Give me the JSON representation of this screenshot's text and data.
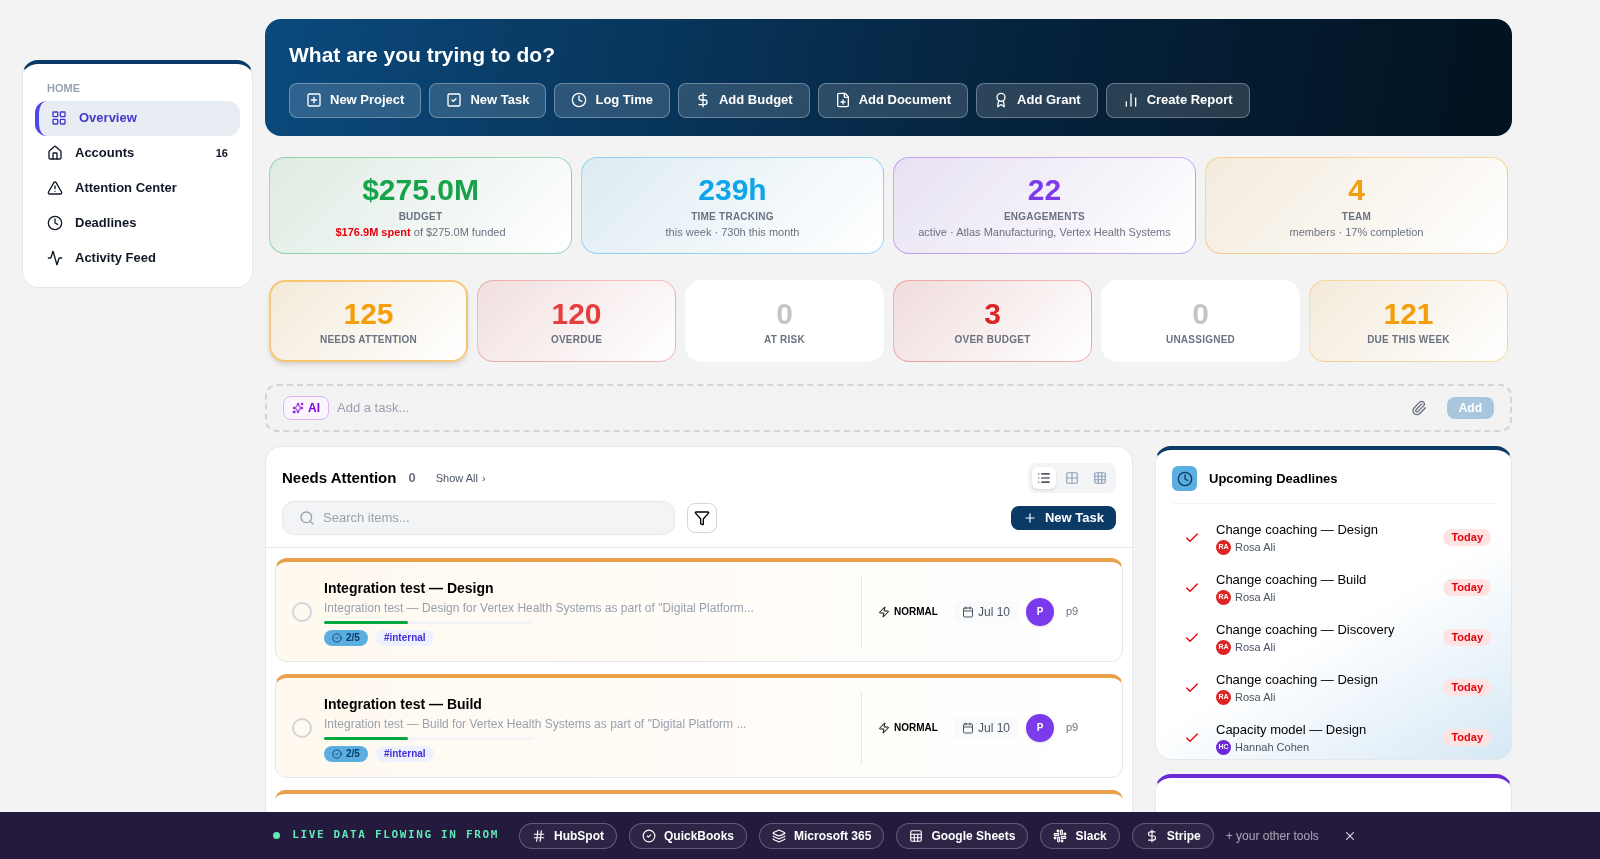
{
  "sidebar": {
    "section": "HOME",
    "items": [
      {
        "label": "Overview",
        "selected": true
      },
      {
        "label": "Accounts",
        "badge": "16",
        "selected": false
      },
      {
        "label": "Attention Center",
        "selected": false
      },
      {
        "label": "Deadlines",
        "selected": false
      },
      {
        "label": "Activity Feed",
        "selected": false
      }
    ]
  },
  "hero": {
    "title": "What are you trying to do?",
    "actions": [
      "New Project",
      "New Task",
      "Log Time",
      "Add Budget",
      "Add Document",
      "Add Grant",
      "Create Report"
    ]
  },
  "stats": [
    {
      "value": "$275.0M",
      "label": "BUDGET",
      "highlight": "$176.9M spent",
      "detail": " of $275.0M funded",
      "color": "#16a34a"
    },
    {
      "value": "239h",
      "label": "TIME TRACKING",
      "detail": "this week · 730h this month",
      "color": "#0ea5e9"
    },
    {
      "value": "22",
      "label": "ENGAGEMENTS",
      "detail": "active · Atlas Manufacturing, Vertex Health Systems",
      "color": "#7c3aed"
    },
    {
      "value": "4",
      "label": "TEAM",
      "detail": "members · 17% completion",
      "color": "#f59e0b"
    }
  ],
  "counters": [
    {
      "value": "125",
      "label": "NEEDS ATTENTION",
      "color": "#f59e0b",
      "selected": true
    },
    {
      "value": "120",
      "label": "OVERDUE",
      "color": "#e53e3e",
      "selected": false
    },
    {
      "value": "0",
      "label": "AT RISK",
      "color": "#c4c4c4",
      "selected": false
    },
    {
      "value": "3",
      "label": "OVER BUDGET",
      "color": "#dc2626",
      "selected": false
    },
    {
      "value": "0",
      "label": "UNASSIGNED",
      "color": "#c4c4c4",
      "selected": false
    },
    {
      "value": "121",
      "label": "DUE THIS WEEK",
      "color": "#f59e0b",
      "selected": false
    }
  ],
  "quick_add": {
    "ai_label": "AI",
    "placeholder": "Add a task...",
    "add_label": "Add"
  },
  "needs_attention": {
    "title": "Needs Attention",
    "count": "0",
    "show_all": "Show All",
    "show_all_arrow": "›",
    "search_placeholder": "Search items...",
    "new_task": "New Task",
    "views": [
      {
        "selected": true
      },
      {
        "selected": false
      },
      {
        "selected": false
      }
    ],
    "tasks": [
      {
        "title": "Integration test — Design",
        "description": "Integration test — Design for Vertex Health Systems as part of \"Digital Platform...",
        "checked": false,
        "level": 0.4,
        "subtasks": "2/5",
        "tag": "#internal",
        "priority": "NORMAL",
        "date": "Jul 10",
        "avatar": "P",
        "owner": "p9"
      },
      {
        "title": "Integration test — Build",
        "description": "Integration test — Build for Vertex Health Systems as part of \"Digital Platform ...",
        "checked": false,
        "level": 0.4,
        "subtasks": "2/5",
        "tag": "#internal",
        "priority": "NORMAL",
        "date": "Jul 10",
        "avatar": "P",
        "owner": "p9"
      }
    ]
  },
  "deadlines": {
    "title": "Upcoming Deadlines",
    "items": [
      {
        "title": "Change coaching — Design",
        "initials": "RA",
        "person": "Rosa Ali",
        "color": "#dc2626",
        "due": "Today"
      },
      {
        "title": "Change coaching — Build",
        "initials": "RA",
        "person": "Rosa Ali",
        "color": "#dc2626",
        "due": "Today"
      },
      {
        "title": "Change coaching — Discovery",
        "initials": "RA",
        "person": "Rosa Ali",
        "color": "#dc2626",
        "due": "Today"
      },
      {
        "title": "Change coaching — Design",
        "initials": "RA",
        "person": "Rosa Ali",
        "color": "#dc2626",
        "due": "Today"
      },
      {
        "title": "Capacity model — Design",
        "initials": "HC",
        "person": "Hannah Cohen",
        "color": "#6d28d9",
        "due": "Today"
      }
    ]
  },
  "integrations": {
    "label": "LIVE DATA FLOWING IN FROM",
    "tools": [
      "HubSpot",
      "QuickBooks",
      "Microsoft 365",
      "Google Sheets",
      "Slack",
      "Stripe"
    ],
    "more": "+ your other tools"
  }
}
